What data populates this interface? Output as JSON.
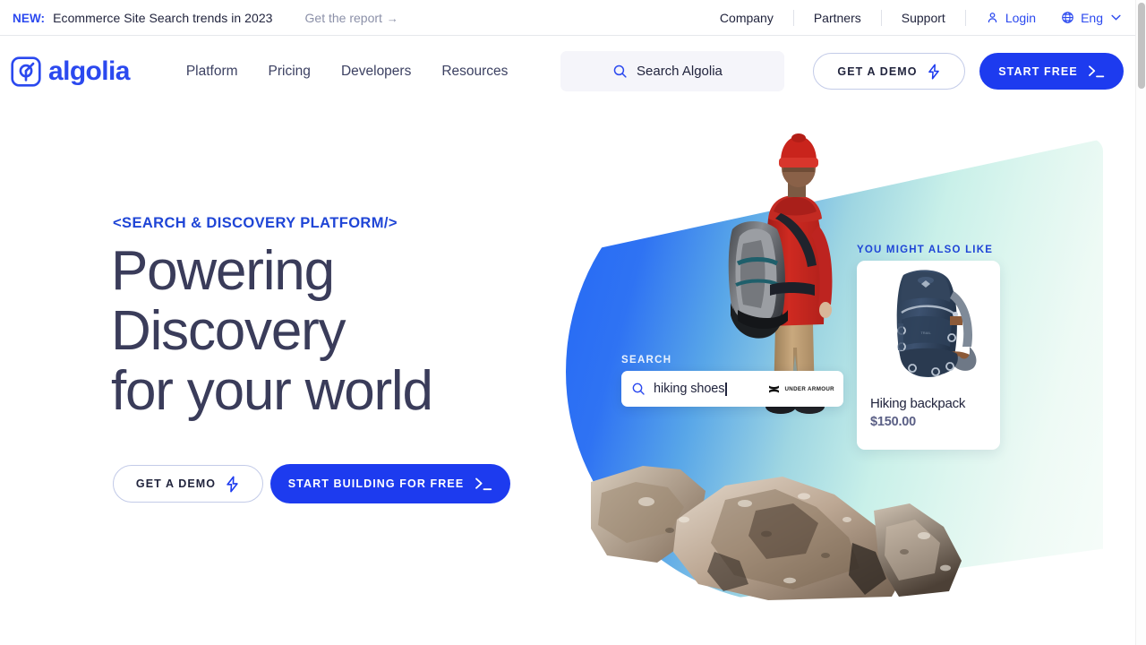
{
  "announcement": {
    "new_label": "NEW:",
    "text": "Ecommerce Site Search trends in 2023",
    "cta": "Get the report",
    "cta_arrow": "→",
    "links": [
      "Company",
      "Partners",
      "Support"
    ],
    "login_label": "Login",
    "language_label": "Eng",
    "chevron": "⌄"
  },
  "nav": {
    "logo_text": "algolia",
    "links": [
      "Platform",
      "Pricing",
      "Developers",
      "Resources"
    ],
    "search_placeholder": "Search Algolia",
    "demo_button": "GET A DEMO",
    "start_button": "START FREE"
  },
  "hero": {
    "eyebrow": "<SEARCH & DISCOVERY PLATFORM/>",
    "title_lines": [
      "Powering",
      "Discovery",
      "for your world"
    ],
    "demo_button": "GET A DEMO",
    "build_button": "START BUILDING FOR FREE"
  },
  "demo_widget": {
    "search_label": "SEARCH",
    "query": "hiking shoes",
    "brand": "UNDER ARMOUR",
    "recommend_label": "YOU MIGHT ALSO LIKE",
    "product": {
      "name": "Hiking backpack",
      "price": "$150.00"
    }
  },
  "colors": {
    "brand_blue": "#2b49ef",
    "button_blue": "#1d3bef",
    "heading_navy": "#3a3c5a",
    "eyebrow_blue": "#1f45d6",
    "muted_gray": "#8b90a8",
    "gradient_start": "#2467f5",
    "gradient_end": "#f7fdfa"
  }
}
